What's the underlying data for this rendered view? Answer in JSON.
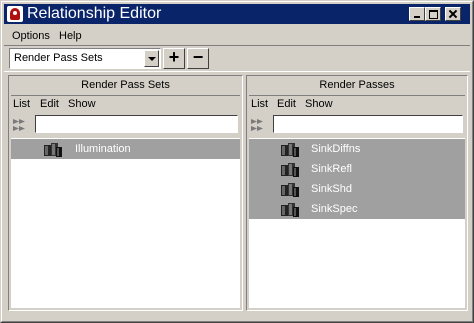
{
  "window": {
    "title": "Relationship Editor"
  },
  "menubar": {
    "options": "Options",
    "help": "Help"
  },
  "toolbar": {
    "mode_value": "Render Pass Sets",
    "add_label": "+",
    "remove_label": "−"
  },
  "left_panel": {
    "title": "Render Pass Sets",
    "menu": {
      "list": "List",
      "edit": "Edit",
      "show": "Show"
    },
    "filter_value": "",
    "items": [
      {
        "label": "Illumination"
      }
    ]
  },
  "right_panel": {
    "title": "Render Passes",
    "menu": {
      "list": "List",
      "edit": "Edit",
      "show": "Show"
    },
    "filter_value": "",
    "items": [
      {
        "label": "SinkDiffns"
      },
      {
        "label": "SinkRefl"
      },
      {
        "label": "SinkShd"
      },
      {
        "label": "SinkSpec"
      }
    ]
  },
  "icons": {
    "set": "render-pass-set-icon",
    "pass": "render-pass-icon",
    "filter": "filter-arrows-icon"
  },
  "colors": {
    "titlebar": "#0a246a",
    "selection": "#a0a0a0",
    "face": "#d4d0c8"
  }
}
